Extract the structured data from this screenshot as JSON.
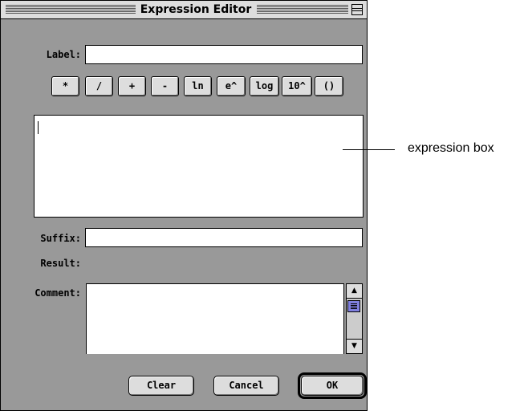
{
  "window": {
    "title": "Expression Editor",
    "zoom_icon": "zoom-box-icon"
  },
  "labels": {
    "label": "Label:",
    "suffix": "Suffix:",
    "result": "Result:",
    "comment": "Comment:"
  },
  "fields": {
    "label_value": "",
    "suffix_value": "",
    "result_value": "",
    "expression_value": "",
    "comment_value": ""
  },
  "operators": [
    "*",
    "/",
    "+",
    "-",
    "ln",
    "e^",
    "log",
    "10^",
    "()"
  ],
  "footer": {
    "clear": "Clear",
    "cancel": "Cancel",
    "ok": "OK"
  },
  "scrollbar": {
    "up_icon": "arrow-up-icon",
    "down_icon": "arrow-down-icon"
  },
  "annotation": {
    "text": "expression box"
  },
  "colors": {
    "window_bg": "#999999",
    "titlebar_bg": "#dddddd",
    "scroll_thumb": "#8080e0"
  }
}
